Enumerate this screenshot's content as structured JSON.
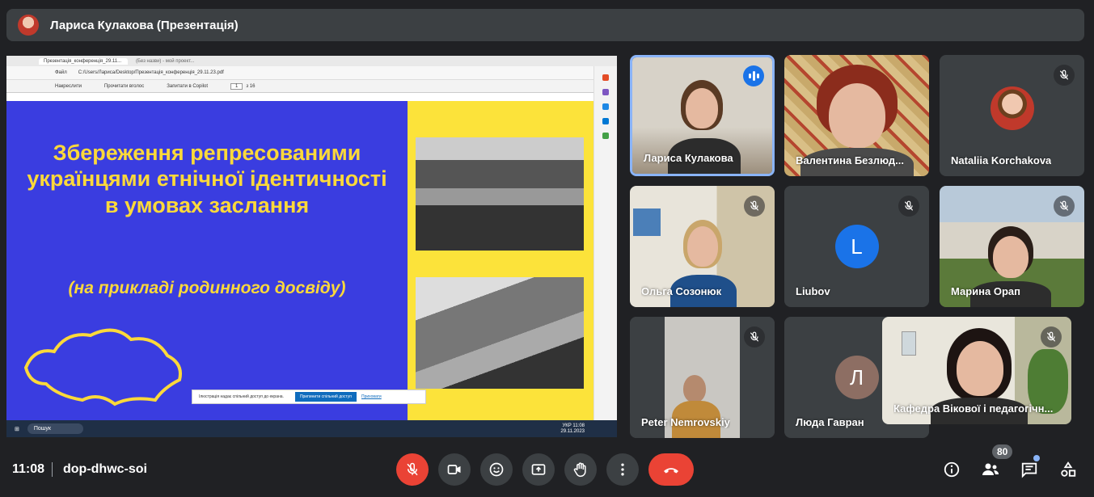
{
  "meeting": {
    "presenter_title": "Лариса Кулакова (Презентація)",
    "time": "11:08",
    "code": "dop-dhwc-soi",
    "participant_count": "80"
  },
  "shared_screen": {
    "browser_tab_active": "Презентація_конференція_29.11...",
    "browser_tab_2": "(Без назви) - мой проект...",
    "address_label": "Файл",
    "url": "C:/Users/Лариса/Desktop/Презентація_конференція_29.11.23.pdf",
    "pdf_tool_1": "Накреслити",
    "pdf_tool_2": "Прочитати вголос",
    "pdf_tool_3": "Запитати в Copilot",
    "page_number": "1",
    "page_total": "з 16",
    "slide_title": "Збереження репресованими українцями етнічної ідентичності в умовах заслання",
    "slide_subtitle": "(на прикладі родинного досвіду)",
    "share_notice": "Ілюстрація надає спільний доступ до екрана.",
    "share_stop": "Припинити спільний доступ",
    "share_hide": "Приховати",
    "taskbar_search": "Пошук",
    "tray_lang": "УКР",
    "tray_time": "11:08",
    "tray_date": "29.11.2023"
  },
  "participants": [
    {
      "name": "Лариса Кулакова",
      "speaking": true
    },
    {
      "name": "Валентина Безлюд...",
      "muted": false
    },
    {
      "name": "Nataliia Korchakova",
      "muted": true
    },
    {
      "name": "Ольга Созонюк",
      "muted": true
    },
    {
      "name": "Liubov",
      "muted": true,
      "initial": "L",
      "color": "#1a73e8"
    },
    {
      "name": "Марина Орап",
      "muted": true
    },
    {
      "name": "Peter Nemrovskiy",
      "muted": true
    },
    {
      "name": "Люда Гавран",
      "muted": false,
      "initial": "Л",
      "color": "#8d6e63"
    },
    {
      "name": "Кафедра Вікової і педагогічн...",
      "muted": true
    }
  ],
  "controls": {
    "mic": "mic-off-icon",
    "camera": "camera-icon",
    "emoji": "emoji-icon",
    "present": "present-icon",
    "hand": "raise-hand-icon",
    "more": "more-vert-icon",
    "leave": "call-end-icon"
  },
  "colors": {
    "accent": "#8ab4f8",
    "danger": "#ea4335",
    "surface": "#3c4043",
    "background": "#202124",
    "slide_blue": "#3a3de0",
    "slide_yellow": "#fcd93a"
  }
}
